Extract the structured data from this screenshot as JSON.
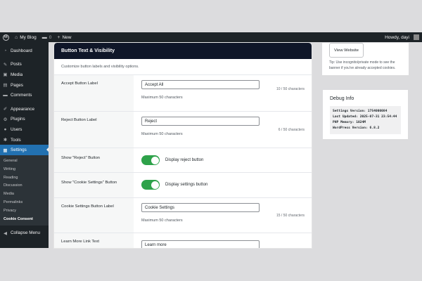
{
  "adminbar": {
    "site_name": "My Blog",
    "comments_count": "0",
    "new_label": "New",
    "greeting": "Howdy, dayi"
  },
  "sidebar": {
    "items_top": [
      {
        "label": "Dashboard",
        "icon": "dashboard-icon"
      }
    ],
    "items_mid": [
      {
        "label": "Posts",
        "icon": "pin-icon"
      },
      {
        "label": "Media",
        "icon": "media-icon"
      },
      {
        "label": "Pages",
        "icon": "page-icon"
      },
      {
        "label": "Comments",
        "icon": "comment-icon"
      }
    ],
    "items_bottom": [
      {
        "label": "Appearance",
        "icon": "brush-icon"
      },
      {
        "label": "Plugins",
        "icon": "plugin-icon"
      },
      {
        "label": "Users",
        "icon": "user-icon"
      },
      {
        "label": "Tools",
        "icon": "wrench-icon"
      },
      {
        "label": "Settings",
        "icon": "settings-icon"
      }
    ],
    "submenu": [
      "General",
      "Writing",
      "Reading",
      "Discussion",
      "Media",
      "Permalinks",
      "Privacy",
      "Cookie Consent"
    ],
    "collapse_label": "Collapse Menu"
  },
  "card": {
    "title": "Button Text & Visibility",
    "description": "Customize button labels and visibility options.",
    "accept": {
      "label": "Accept Button Label",
      "value": "Accept All",
      "count": "10 / 50 characters",
      "help": "Maximum 50 characters"
    },
    "reject": {
      "label": "Reject Button Label",
      "value": "Reject",
      "count": "6 / 50 characters",
      "help": "Maximum 50 characters"
    },
    "show_reject": {
      "label": "Show \"Reject\" Button",
      "toggle_label": "Display reject button",
      "enabled": true
    },
    "show_settings": {
      "label": "Show \"Cookie Settings\" Button",
      "toggle_label": "Display settings button",
      "enabled": true
    },
    "settings_button": {
      "label": "Cookie Settings Button Label",
      "value": "Cookie Settings",
      "count": "15 / 50 characters",
      "help": "Maximum 50 characters"
    },
    "learn_more": {
      "label": "Learn More Link Text",
      "value": "Learn more"
    }
  },
  "right": {
    "view_button": "View Website",
    "tip": "Tip: Use incognito/private mode to see the banner if you've already accepted cookies.",
    "debug_title": "Debug Info",
    "debug_lines": [
      "Settings Version: 1754000084",
      "Last Updated: 2025-07-31 23:54:44",
      "PHP Memory: 1024M",
      "WordPress Version: 6.8.2"
    ]
  },
  "colors": {
    "admin_dark": "#1d2327",
    "accent_blue": "#2271b1",
    "toggle_green": "#2ea24a",
    "card_header": "#0f1628"
  }
}
